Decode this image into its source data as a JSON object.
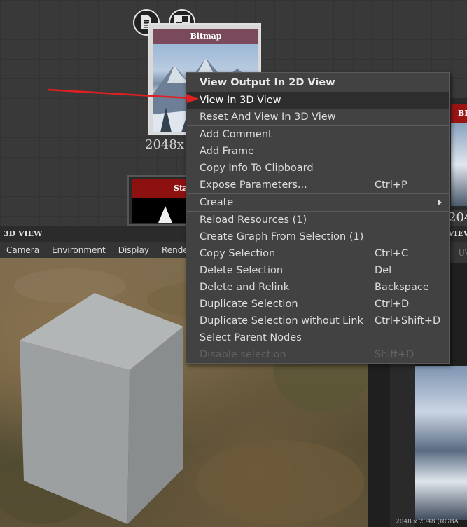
{
  "graph": {
    "bitmap_node": {
      "title": "Bitmap",
      "size_label": "2048x"
    },
    "state_node": {
      "title": "Sta"
    },
    "bb_node": {
      "title": "BB",
      "size_label": "204"
    },
    "icons": [
      "document-icon",
      "checker-icon"
    ]
  },
  "view3d": {
    "title": "3D VIEW",
    "menu": [
      "Camera",
      "Environment",
      "Display",
      "Renderer"
    ]
  },
  "view2d": {
    "title": "VIEW",
    "menu_partial": "UV",
    "status": "2048 x 2048 (RGBA"
  },
  "context_menu": {
    "items": [
      {
        "label": "View Output In 2D View",
        "shortcut": "",
        "state": "header"
      },
      {
        "label": "View In 3D View",
        "shortcut": "",
        "state": "highlighted"
      },
      {
        "label": "Reset And View In 3D View",
        "shortcut": "",
        "state": "normal"
      },
      {
        "label": "Add Comment",
        "shortcut": "",
        "state": "normal"
      },
      {
        "label": "Add Frame",
        "shortcut": "",
        "state": "normal"
      },
      {
        "label": "Copy Info To Clipboard",
        "shortcut": "",
        "state": "normal"
      },
      {
        "label": "Expose Parameters...",
        "shortcut": "Ctrl+P",
        "state": "normal"
      },
      {
        "label": "Create",
        "shortcut": "",
        "state": "submenu"
      },
      {
        "label": "Reload Resources (1)",
        "shortcut": "",
        "state": "normal"
      },
      {
        "label": "Create Graph From Selection (1)",
        "shortcut": "",
        "state": "normal"
      },
      {
        "label": "Copy Selection",
        "shortcut": "Ctrl+C",
        "state": "normal"
      },
      {
        "label": "Delete Selection",
        "shortcut": "Del",
        "state": "normal"
      },
      {
        "label": "Delete and Relink",
        "shortcut": "Backspace",
        "state": "normal"
      },
      {
        "label": "Duplicate Selection",
        "shortcut": "Ctrl+D",
        "state": "normal"
      },
      {
        "label": "Duplicate Selection without Link",
        "shortcut": "Ctrl+Shift+D",
        "state": "normal"
      },
      {
        "label": "Select Parent Nodes",
        "shortcut": "",
        "state": "normal"
      },
      {
        "label": "Disable selection",
        "shortcut": "Shift+D",
        "state": "disabled"
      }
    ]
  },
  "colors": {
    "menu_bg": "#424242",
    "highlight": "#2d2d2d",
    "annotation_arrow": "#e02020",
    "node_header_red": "#8e1111",
    "bitmap_header": "#7a4a5c"
  }
}
